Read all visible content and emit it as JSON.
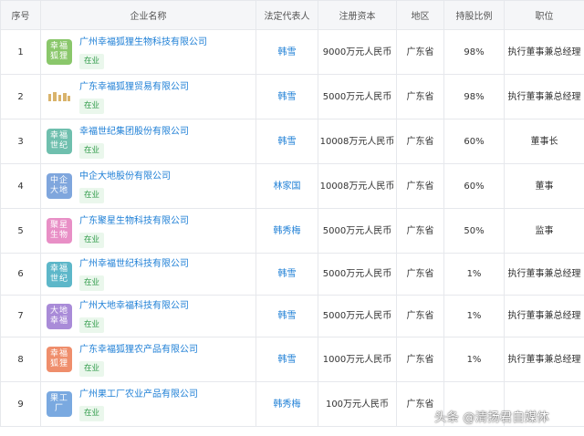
{
  "headers": {
    "idx": "序号",
    "name": "企业名称",
    "rep": "法定代表人",
    "capital": "注册资本",
    "region": "地区",
    "share": "持股比例",
    "position": "职位"
  },
  "rows": [
    {
      "idx": "1",
      "logo": "幸福狐狸",
      "logo_color": "#8ac76b",
      "name": "广州幸福狐狸生物科技有限公司",
      "status": "在业",
      "rep": "韩雪",
      "capital": "9000万元人民币",
      "region": "广东省",
      "share": "98%",
      "position": "执行董事兼总经理"
    },
    {
      "idx": "2",
      "logo": "",
      "logo_color": "#d9b36c",
      "name": "广东幸福狐狸贸易有限公司",
      "status": "在业",
      "rep": "韩雪",
      "capital": "5000万元人民币",
      "region": "广东省",
      "share": "98%",
      "position": "执行董事兼总经理"
    },
    {
      "idx": "3",
      "logo": "幸福世纪",
      "logo_color": "#6fbfae",
      "name": "幸福世纪集团股份有限公司",
      "status": "在业",
      "rep": "韩雪",
      "capital": "10008万元人民币",
      "region": "广东省",
      "share": "60%",
      "position": "董事长"
    },
    {
      "idx": "4",
      "logo": "中企大地",
      "logo_color": "#7fa6dd",
      "name": "中企大地股份有限公司",
      "status": "在业",
      "rep": "林家国",
      "capital": "10008万元人民币",
      "region": "广东省",
      "share": "60%",
      "position": "董事"
    },
    {
      "idx": "5",
      "logo": "聚星生物",
      "logo_color": "#e88fc6",
      "name": "广东聚星生物科技有限公司",
      "status": "在业",
      "rep": "韩秀梅",
      "capital": "5000万元人民币",
      "region": "广东省",
      "share": "50%",
      "position": "监事"
    },
    {
      "idx": "6",
      "logo": "幸福世纪",
      "logo_color": "#5db7c9",
      "name": "广州幸福世纪科技有限公司",
      "status": "在业",
      "rep": "韩雪",
      "capital": "5000万元人民币",
      "region": "广东省",
      "share": "1%",
      "position": "执行董事兼总经理"
    },
    {
      "idx": "7",
      "logo": "大地幸福",
      "logo_color": "#a98bd8",
      "name": "广州大地幸福科技有限公司",
      "status": "在业",
      "rep": "韩雪",
      "capital": "5000万元人民币",
      "region": "广东省",
      "share": "1%",
      "position": "执行董事兼总经理"
    },
    {
      "idx": "8",
      "logo": "幸福狐狸",
      "logo_color": "#ef8e6c",
      "name": "广东幸福狐狸农产品有限公司",
      "status": "在业",
      "rep": "韩雪",
      "capital": "1000万元人民币",
      "region": "广东省",
      "share": "1%",
      "position": "执行董事兼总经理"
    },
    {
      "idx": "9",
      "logo": "果工厂",
      "logo_color": "#7aa9e0",
      "name": "广州果工厂农业产品有限公司",
      "status": "在业",
      "rep": "韩秀梅",
      "capital": "100万元人民币",
      "region": "广东省",
      "share": "",
      "position": ""
    }
  ],
  "watermark": "头条 @清扬君自媒体"
}
